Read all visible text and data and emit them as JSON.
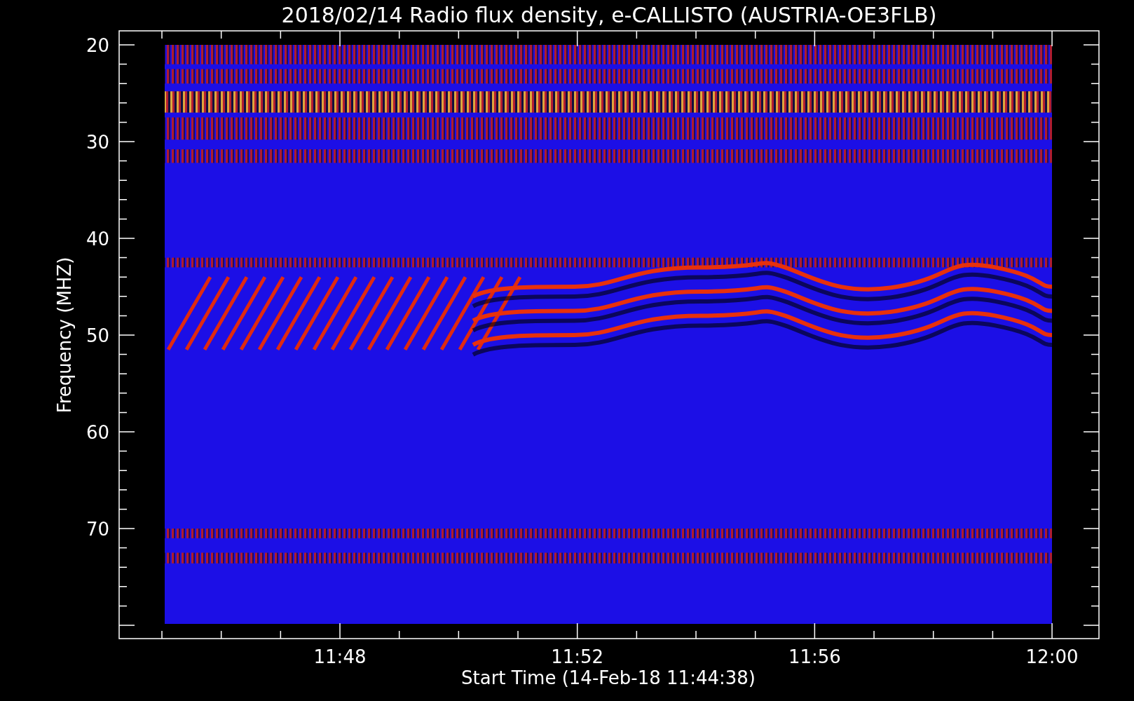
{
  "title": "2018/02/14  Radio flux density, e-CALLISTO (AUSTRIA-OE3FLB)",
  "y_axis": {
    "label": "Frequency (MHZ)",
    "ticks": [
      "20",
      "30",
      "40",
      "50",
      "60",
      "70"
    ]
  },
  "x_axis": {
    "label": "Start Time (14-Feb-18 11:44:38)",
    "ticks": [
      "11:48",
      "11:52",
      "11:56",
      "12:00"
    ]
  }
}
